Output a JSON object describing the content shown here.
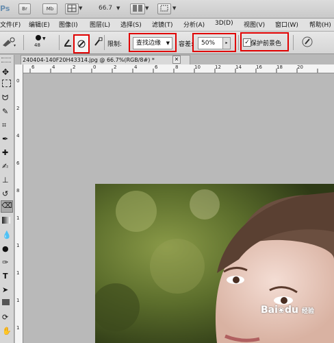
{
  "app": {
    "logo": "Ps",
    "bridge_button": "Br",
    "minibridge_button": "Mb",
    "zoom_value": "66.7"
  },
  "menu": {
    "items": [
      "文件(F)",
      "编辑(E)",
      "图像(I)",
      "图层(L)",
      "选择(S)",
      "滤镜(T)",
      "分析(A)",
      "3D(D)",
      "视图(V)",
      "窗口(W)",
      "帮助(H)"
    ]
  },
  "options": {
    "brush_size": "48",
    "limit_label": "限制:",
    "limit_value": "查找边缘",
    "tolerance_label": "容差:",
    "tolerance_value": "50%",
    "protect_foreground_label": "保护前景色",
    "protect_foreground_checked": true
  },
  "document": {
    "tab_title": "240404-140F20H43314.jpg @ 66.7%(RGB/8#) *"
  },
  "ruler": {
    "h_ticks": [
      "6",
      "4",
      "2",
      "0",
      "2",
      "4",
      "6",
      "8",
      "10",
      "12",
      "14",
      "16",
      "18",
      "20"
    ],
    "v_ticks": [
      "0",
      "2",
      "4",
      "6",
      "8",
      "1",
      "1",
      "1",
      "1",
      "1"
    ]
  },
  "watermark": {
    "text": "Bai",
    "paw": "du",
    "sub": "经验"
  }
}
